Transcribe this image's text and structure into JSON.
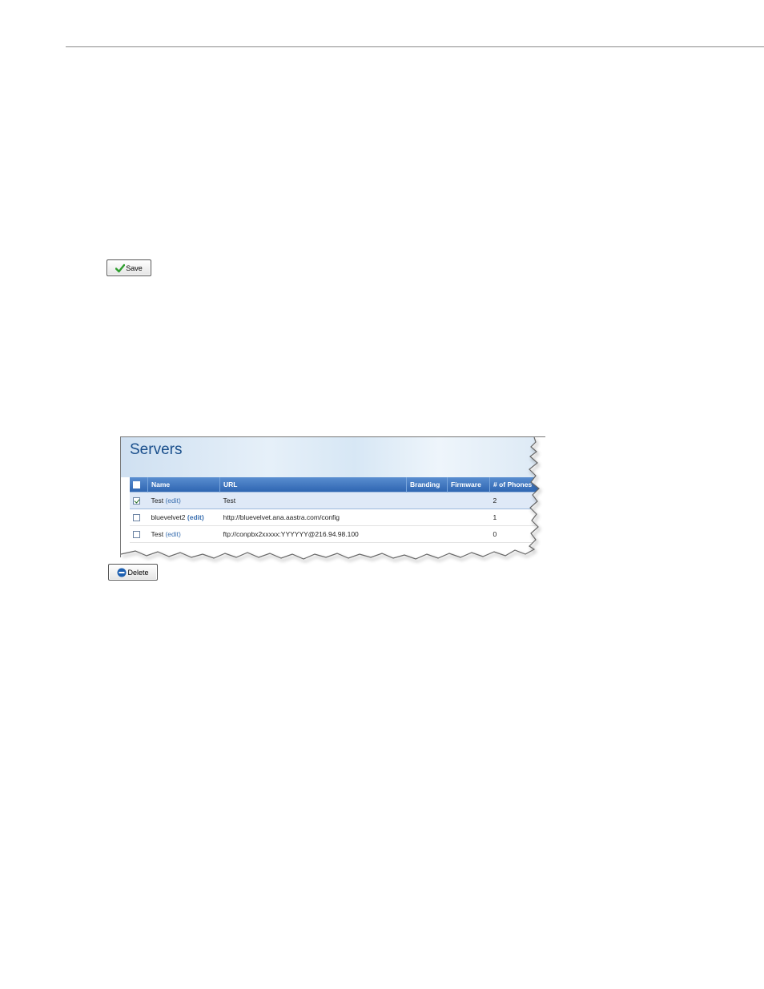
{
  "save_button": {
    "label": "Save",
    "icon": "checkmark-icon",
    "icon_color": "#2e9e2e"
  },
  "delete_button": {
    "label": "Delete",
    "icon": "minus-circle-icon",
    "icon_color": "#1d5fb0"
  },
  "servers_panel": {
    "title": "Servers",
    "columns": [
      "Name",
      "URL",
      "Branding",
      "Firmware",
      "# of Phones"
    ],
    "rows": [
      {
        "checked": true,
        "name": "Test",
        "edit": "(edit)",
        "url": "Test",
        "branding": "",
        "firmware": "",
        "phones": "2"
      },
      {
        "checked": false,
        "name": "bluevelvet2",
        "edit": "(edit)",
        "url": "http://bluevelvet.ana.aastra.com/config",
        "branding": "",
        "firmware": "",
        "phones": "1"
      },
      {
        "checked": false,
        "name": "Test",
        "edit": "(edit)",
        "url": "ftp://conpbx2xxxxx:YYYYYY@216.94.98.100",
        "branding": "",
        "firmware": "",
        "phones": "0"
      }
    ]
  }
}
